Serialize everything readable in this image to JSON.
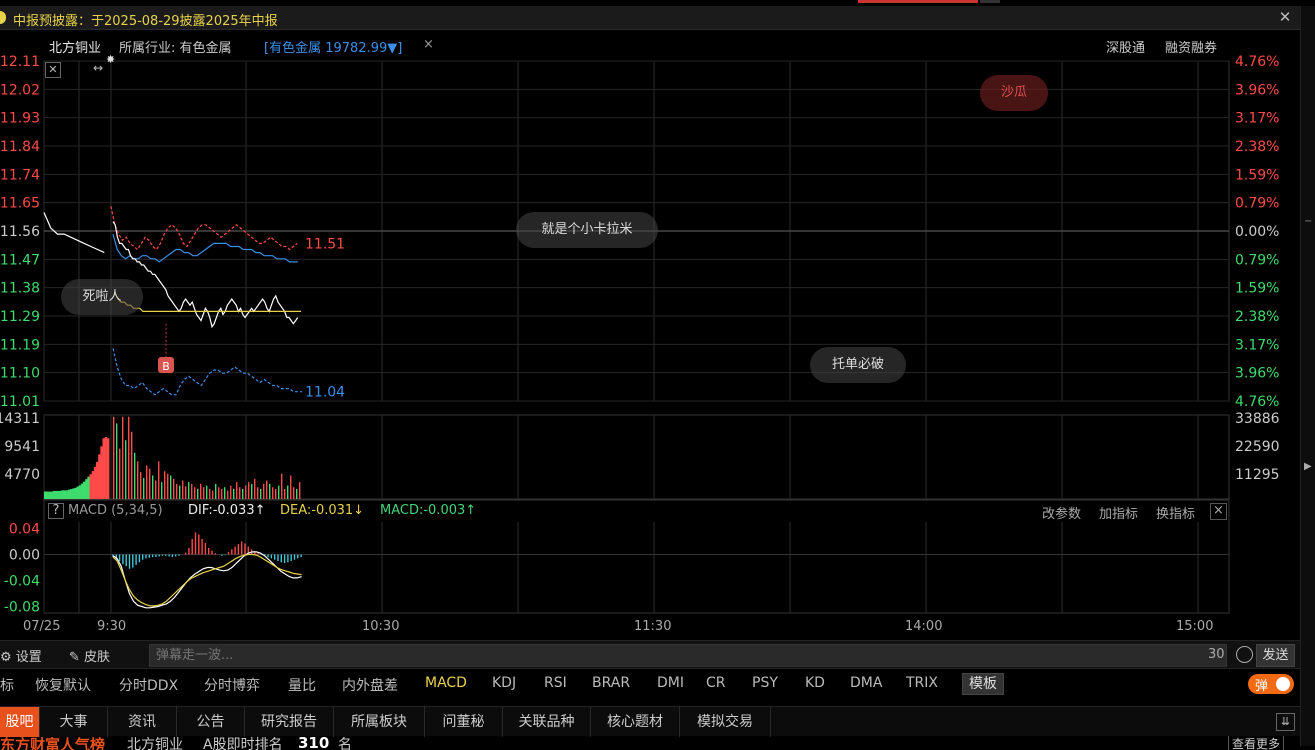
{
  "notice": {
    "text": "中报预披露：于2025-08-29披露2025年中报"
  },
  "info": {
    "stock_name": "北方铜业",
    "industry_label": "所属行业: 有色金属",
    "industry_link": "[有色金属 19782.99▼]",
    "close_mark": "×",
    "tag_sgt": "深股通",
    "tag_rz": "融资融券"
  },
  "danmaku": {
    "d1": "就是个小卡拉米",
    "d2": "死啦人",
    "d3": "托单必破",
    "d4": "沙瓜"
  },
  "colors": {
    "up": "#ff4a4a",
    "down": "#3ddc6c",
    "avg": "#e8d24a",
    "price": "#ffffff",
    "blue": "#3a8fe8",
    "accent": "#e8501c"
  },
  "price_axis": {
    "left": [
      "12.11",
      "12.02",
      "11.93",
      "11.84",
      "11.74",
      "11.65",
      "11.56",
      "11.47",
      "11.38",
      "11.29",
      "11.19",
      "11.10",
      "11.01"
    ],
    "right": [
      "4.76%",
      "3.96%",
      "3.17%",
      "2.38%",
      "1.59%",
      "0.79%",
      "0.00%",
      "0.79%",
      "1.59%",
      "2.38%",
      "3.17%",
      "3.96%",
      "4.76%"
    ],
    "prev_close": 11.56,
    "min": 11.01,
    "max": 12.11
  },
  "series_labels": {
    "upper_band": "11.51",
    "lower_band": "11.04",
    "buy_marker": "B"
  },
  "volume_axis": {
    "left": [
      "14311",
      "9541",
      "4770"
    ],
    "right": [
      "33886",
      "22590",
      "11295"
    ]
  },
  "macd": {
    "help": "?",
    "name": "MACD (5,34,5)",
    "dif": "DIF:-0.033↑",
    "dea": "DEA:-0.031↓",
    "value": "MACD:-0.003↑",
    "opt_params": "改参数",
    "opt_add": "加指标",
    "opt_swap": "换指标",
    "close": "×",
    "axis": [
      "0.04",
      "0.00",
      "-0.04",
      "-0.08"
    ]
  },
  "time_axis": [
    "07/25",
    "9:30",
    "10:30",
    "11:30",
    "14:00",
    "15:00"
  ],
  "toolbar": {
    "settings": "⚙ 设置",
    "skin": "✎ 皮肤",
    "placeholder": "弹幕走一波...",
    "count": "30",
    "send": "发送"
  },
  "indicator_tabs": [
    "标",
    "恢复默认",
    "分时DDX",
    "分时博弈",
    "量比",
    "内外盘差",
    "MACD",
    "KDJ",
    "RSI",
    "BRAR",
    "DMI",
    "CR",
    "PSY",
    "KD",
    "DMA",
    "TRIX"
  ],
  "indicator_active": "MACD",
  "template_btn": "模板",
  "danmu_toggle": "弹",
  "bottom_tabs": [
    "股吧",
    "大事",
    "资讯",
    "公告",
    "研究报告",
    "所属板块",
    "问董秘",
    "关联品种",
    "核心题材",
    "模拟交易"
  ],
  "rank": {
    "title": "东方财富人气榜",
    "stock": "北方铜业",
    "label": "A股即时排名",
    "number": "310",
    "unit": "名",
    "more": "查看更多"
  },
  "price_series": [
    11.59,
    11.58,
    11.54,
    11.52,
    11.52,
    11.51,
    11.5,
    11.5,
    11.48,
    11.47,
    11.47,
    11.46,
    11.46,
    11.45,
    11.45,
    11.44,
    11.43,
    11.43,
    11.42,
    11.42,
    11.41,
    11.4,
    11.39,
    11.38,
    11.37,
    11.35,
    11.34,
    11.33,
    11.32,
    11.31,
    11.3,
    11.31,
    11.33,
    11.34,
    11.33,
    11.32,
    11.33,
    11.31,
    11.29,
    11.28,
    11.27,
    11.29,
    11.31,
    11.3,
    11.28,
    11.25,
    11.26,
    11.28,
    11.3,
    11.31,
    11.29,
    11.3,
    11.32,
    11.33,
    11.34,
    11.33,
    11.32,
    11.3,
    11.31,
    11.29,
    11.28,
    11.29,
    11.3,
    11.31,
    11.3,
    11.31,
    11.32,
    11.33,
    11.34,
    11.33,
    11.31,
    11.3,
    11.32,
    11.34,
    11.35,
    11.33,
    11.32,
    11.31,
    11.3,
    11.28,
    11.28,
    11.27,
    11.26,
    11.27,
    11.28
  ],
  "avg_series": [
    11.36,
    11.34,
    11.33,
    11.33,
    11.32,
    11.32,
    11.31,
    11.31,
    11.31,
    11.3,
    11.3,
    11.3,
    11.3,
    11.3,
    11.3,
    11.3,
    11.3,
    11.3,
    11.3,
    11.3,
    11.3,
    11.3,
    11.3,
    11.3,
    11.3,
    11.3,
    11.3,
    11.3,
    11.3,
    11.3,
    11.3,
    11.3,
    11.3,
    11.3,
    11.3,
    11.3,
    11.3,
    11.3,
    11.3,
    11.3,
    11.3,
    11.3,
    11.3,
    11.3,
    11.3,
    11.3,
    11.3,
    11.3,
    11.3,
    11.3,
    11.3,
    11.3,
    11.3,
    11.3,
    11.3,
    11.3,
    11.3,
    11.3,
    11.3,
    11.3,
    11.3
  ],
  "upper_series": [
    11.64,
    11.58,
    11.55,
    11.53,
    11.54,
    11.52,
    11.51,
    11.5,
    11.52,
    11.54,
    11.53,
    11.51,
    11.5,
    11.52,
    11.55,
    11.57,
    11.58,
    11.57,
    11.55,
    11.52,
    11.51,
    11.53,
    11.55,
    11.57,
    11.58,
    11.58,
    11.57,
    11.56,
    11.55,
    11.54,
    11.55,
    11.56,
    11.57,
    11.58,
    11.57,
    11.56,
    11.55,
    11.54,
    11.53,
    11.52,
    11.52,
    11.53,
    11.54,
    11.53,
    11.52,
    11.51,
    11.51,
    11.5,
    11.51,
    11.52
  ],
  "middle_series": [
    11.55,
    11.5,
    11.48,
    11.47,
    11.48,
    11.47,
    11.47,
    11.48,
    11.48,
    11.47,
    11.47,
    11.46,
    11.47,
    11.48,
    11.49,
    11.5,
    11.5,
    11.49,
    11.49,
    11.48,
    11.48,
    11.49,
    11.5,
    11.51,
    11.52,
    11.52,
    11.52,
    11.52,
    11.51,
    11.51,
    11.51,
    11.5,
    11.5,
    11.5,
    11.49,
    11.49,
    11.48,
    11.48,
    11.48,
    11.47,
    11.47,
    11.47,
    11.46,
    11.46,
    11.46
  ],
  "lower_series": [
    11.18,
    11.12,
    11.08,
    11.06,
    11.06,
    11.05,
    11.06,
    11.07,
    11.05,
    11.04,
    11.03,
    11.04,
    11.05,
    11.04,
    11.03,
    11.03,
    11.06,
    11.08,
    11.09,
    11.08,
    11.07,
    11.06,
    11.08,
    11.1,
    11.11,
    11.11,
    11.1,
    11.1,
    11.11,
    11.12,
    11.11,
    11.1,
    11.1,
    11.09,
    11.08,
    11.07,
    11.08,
    11.07,
    11.06,
    11.06,
    11.05,
    11.05,
    11.05,
    11.04,
    11.04,
    11.04
  ],
  "pre_series": [
    11.62,
    11.57,
    11.55,
    11.55,
    11.54,
    11.53,
    11.52,
    11.51,
    11.5,
    11.49
  ],
  "pre_volume": [
    0.12,
    0.12,
    0.12,
    0.12,
    0.13,
    0.13,
    0.13,
    0.13,
    0.14,
    0.14,
    0.14,
    0.15,
    0.16,
    0.17,
    0.18,
    0.2,
    0.22,
    0.25,
    0.28,
    0.32,
    0.36,
    0.4,
    0.45,
    0.52,
    0.6,
    0.72,
    0.85,
    0.98,
    1.0,
    0.98
  ],
  "volume": [
    0.98,
    0.9,
    0.6,
    0.98,
    0.7,
    0.98,
    0.8,
    0.55,
    0.45,
    0.32,
    0.25,
    0.4,
    0.36,
    0.28,
    0.22,
    0.45,
    0.2,
    0.33,
    0.3,
    0.28,
    0.24,
    0.18,
    0.16,
    0.22,
    0.15,
    0.2,
    0.18,
    0.14,
    0.12,
    0.18,
    0.14,
    0.16,
    0.12,
    0.1,
    0.18,
    0.14,
    0.12,
    0.14,
    0.1,
    0.16,
    0.12,
    0.2,
    0.14,
    0.12,
    0.16,
    0.2,
    0.18,
    0.24,
    0.14,
    0.12,
    0.18,
    0.22,
    0.18,
    0.14,
    0.12,
    0.16,
    0.3,
    0.12,
    0.16,
    0.28,
    0.14,
    0.12,
    0.2
  ],
  "macd_bars": [
    -0.004,
    -0.008,
    -0.01,
    -0.015,
    -0.018,
    -0.022,
    -0.02,
    -0.016,
    -0.012,
    -0.008,
    -0.006,
    -0.005,
    -0.004,
    -0.004,
    -0.003,
    -0.002,
    -0.002,
    -0.003,
    -0.004,
    -0.003,
    -0.002,
    0.0,
    0.003,
    0.01,
    0.024,
    0.034,
    0.031,
    0.024,
    0.018,
    0.01,
    0.006,
    0.002,
    0.0,
    -0.002,
    -0.001,
    0.004,
    0.008,
    0.012,
    0.016,
    0.02,
    0.017,
    0.012,
    0.008,
    0.005,
    0.002,
    0.0,
    -0.002,
    -0.004,
    -0.006,
    -0.008,
    -0.01,
    -0.012,
    -0.013,
    -0.012,
    -0.01,
    -0.008,
    -0.006,
    -0.004
  ],
  "dif_series": [
    -0.002,
    -0.006,
    -0.018,
    -0.04,
    -0.06,
    -0.072,
    -0.078,
    -0.08,
    -0.082,
    -0.082,
    -0.081,
    -0.08,
    -0.078,
    -0.076,
    -0.072,
    -0.066,
    -0.058,
    -0.05,
    -0.042,
    -0.035,
    -0.03,
    -0.026,
    -0.022,
    -0.02,
    -0.02,
    -0.022,
    -0.024,
    -0.025,
    -0.024,
    -0.02,
    -0.014,
    -0.008,
    -0.002,
    0.002,
    0.004,
    0.004,
    0.002,
    -0.002,
    -0.008,
    -0.014,
    -0.02,
    -0.026,
    -0.03,
    -0.034,
    -0.036,
    -0.036,
    -0.034
  ],
  "dea_series": [
    -0.004,
    -0.01,
    -0.024,
    -0.04,
    -0.054,
    -0.064,
    -0.07,
    -0.074,
    -0.077,
    -0.079,
    -0.079,
    -0.078,
    -0.076,
    -0.072,
    -0.066,
    -0.06,
    -0.054,
    -0.048,
    -0.042,
    -0.037,
    -0.034,
    -0.031,
    -0.028,
    -0.026,
    -0.024,
    -0.022,
    -0.02,
    -0.018,
    -0.014,
    -0.01,
    -0.006,
    -0.003,
    -0.001,
    0.0,
    0.0,
    -0.001,
    -0.004,
    -0.008,
    -0.012,
    -0.016,
    -0.02,
    -0.023,
    -0.025,
    -0.027,
    -0.029,
    -0.03,
    -0.031
  ]
}
